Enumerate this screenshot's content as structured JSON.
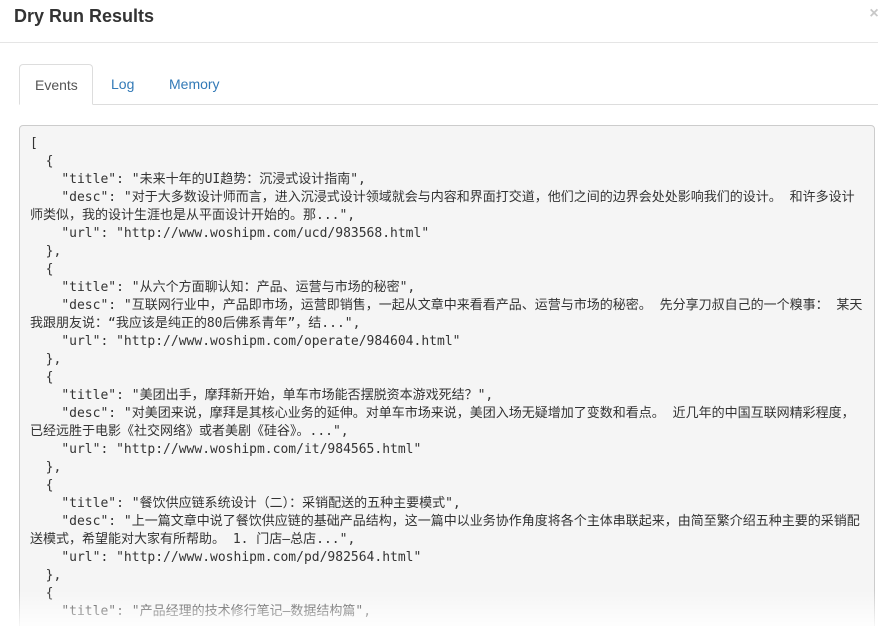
{
  "modal": {
    "title": "Dry Run Results",
    "close_label": "×"
  },
  "tabs": [
    {
      "label": "Events",
      "active": true
    },
    {
      "label": "Log",
      "active": false
    },
    {
      "label": "Memory",
      "active": false
    }
  ],
  "results": {
    "text": "[\n  {\n    \"title\": \"未来十年的UI趋势：沉浸式设计指南\",\n    \"desc\": \"对于大多数设计师而言，进入沉浸式设计领域就会与内容和界面打交道，他们之间的边界会处处影响我们的设计。 和许多设计师类似，我的设计生涯也是从平面设计开始的。那...\",\n    \"url\": \"http://www.woshipm.com/ucd/983568.html\"\n  },\n  {\n    \"title\": \"从六个方面聊认知：产品、运营与市场的秘密\",\n    \"desc\": \"互联网行业中，产品即市场，运营即销售，一起从文章中来看看产品、运营与市场的秘密。 先分享刀叔自己的一个糗事： 某天我跟朋友说：“我应该是纯正的80后佛系青年”，结...\",\n    \"url\": \"http://www.woshipm.com/operate/984604.html\"\n  },\n  {\n    \"title\": \"美团出手，摩拜新开始，单车市场能否摆脱资本游戏死结？\",\n    \"desc\": \"对美团来说，摩拜是其核心业务的延伸。对单车市场来说，美团入场无疑增加了变数和看点。 近几年的中国互联网精彩程度，已经远胜于电影《社交网络》或者美剧《硅谷》。...\",\n    \"url\": \"http://www.woshipm.com/it/984565.html\"\n  },\n  {\n    \"title\": \"餐饮供应链系统设计（二）：采销配送的五种主要模式\",\n    \"desc\": \"上一篇文章中说了餐饮供应链的基础产品结构，这一篇中以业务协作角度将各个主体串联起来，由简至繁介绍五种主要的采销配送模式，希望能对大家有所帮助。 1. 门店—总店...\",\n    \"url\": \"http://www.woshipm.com/pd/982564.html\"\n  },\n  {\n    \"title\": \"产品经理的技术修行笔记—数据结构篇\","
  }
}
